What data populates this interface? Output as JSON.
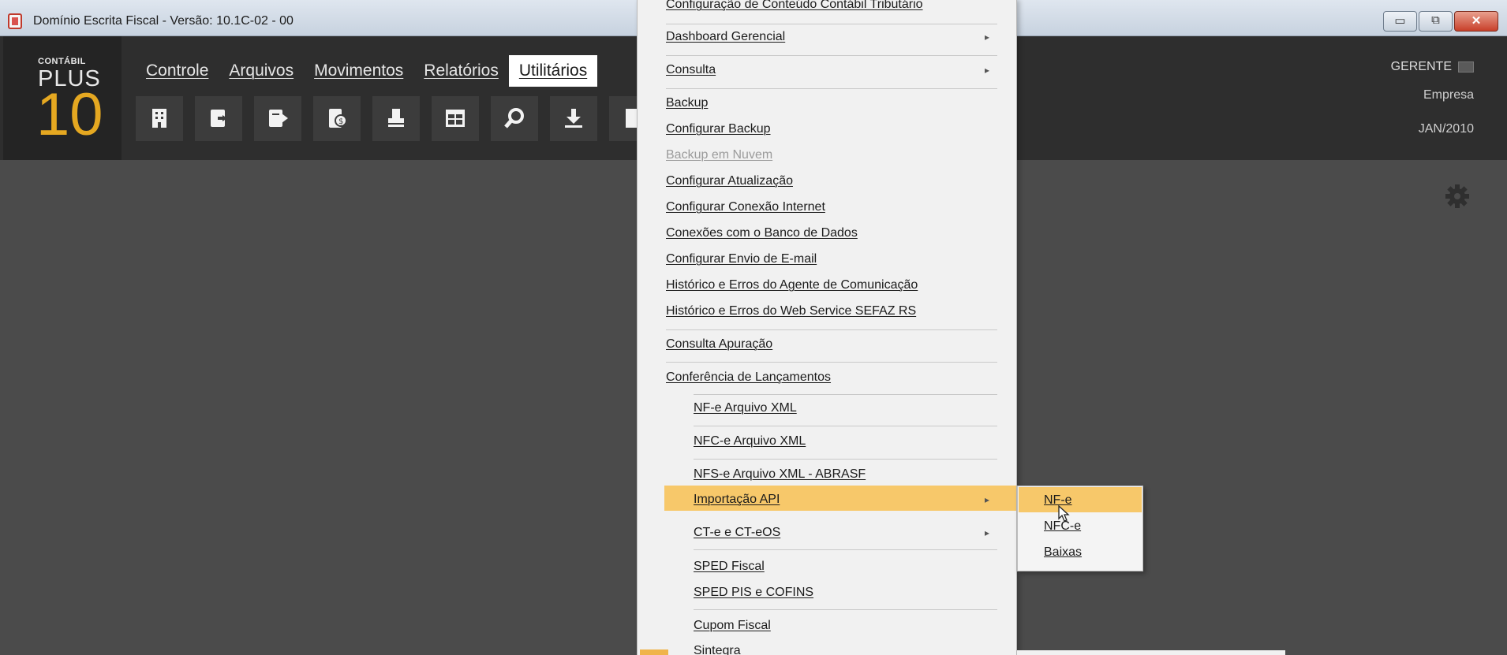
{
  "window": {
    "title": "Domínio Escrita Fiscal  - Versão: 10.1C-02 - 00",
    "min_label": "▭",
    "max_label": "⧉",
    "close_label": "✕"
  },
  "logo": {
    "line1": "CONTÁBIL",
    "line2": "PLUS",
    "line3": "10"
  },
  "menubar": {
    "controle": "Controle",
    "arquivos": "Arquivos",
    "movimentos": "Movimentos",
    "relatorios": "Relatórios",
    "utilitarios": "Utilitários"
  },
  "user": {
    "name": "GERENTE",
    "company": "Empresa",
    "period": "JAN/2010"
  },
  "dropdown": {
    "item_config_conteudo": "Configuração de Conteúdo Contábil Tributário",
    "item_dashboard": "Dashboard Gerencial",
    "item_consulta": "Consulta",
    "item_backup": "Backup",
    "item_config_backup": "Configurar Backup",
    "item_backup_nuvem": "Backup em Nuvem",
    "item_config_atualizacao": "Configurar Atualização",
    "item_config_conexao": "Configurar Conexão Internet",
    "item_conexoes_bd": "Conexões com o Banco de Dados",
    "item_config_email": "Configurar Envio de E-mail",
    "item_hist_agente": "Histórico e Erros do Agente de Comunicação",
    "item_hist_sefaz": "Histórico e Erros do Web Service SEFAZ RS",
    "item_consulta_apuracao": "Consulta Apuração",
    "item_conferencia": "Conferência de Lançamentos",
    "item_nfe_xml": "NF-e Arquivo XML",
    "item_nfce_xml": "NFC-e Arquivo XML",
    "item_nfse_xml": "NFS-e Arquivo XML - ABRASF",
    "item_importacao_api": "Importação API",
    "item_cte": "CT-e e CT-eOS",
    "item_sped_fiscal": "SPED Fiscal",
    "item_sped_pis": "SPED PIS e COFINS",
    "item_cupom": "Cupom Fiscal",
    "item_sintegra": "Sintegra"
  },
  "submenu": {
    "nfe": "NF-e",
    "nfce": "NFC-e",
    "baixas": "Baixas"
  },
  "colors": {
    "highlight": "#f7c86a",
    "logo_accent": "#e5a821",
    "header_bg": "#2e2e2e",
    "workspace_bg": "#4b4b4b"
  }
}
